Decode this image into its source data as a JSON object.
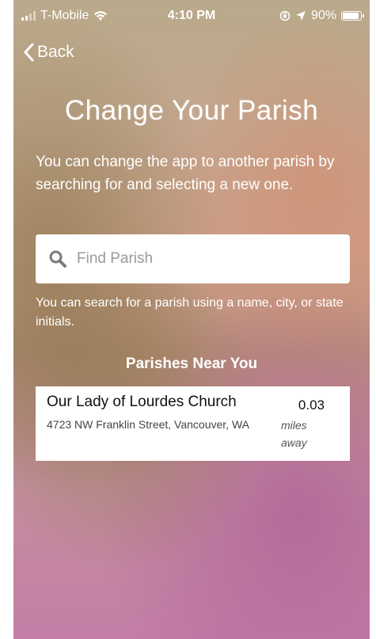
{
  "status_bar": {
    "carrier": "T-Mobile",
    "time": "4:10 PM",
    "battery": "90%",
    "battery_level": 0.9
  },
  "nav": {
    "back_label": "Back"
  },
  "page": {
    "title": "Change Your Parish",
    "intro": "You can change the app to another parish by searching for and selecting a new one.",
    "search_placeholder": "Find Parish",
    "hint": "You can search for a parish using a name, city, or state initials.",
    "section_heading": "Parishes Near You"
  },
  "parishes": [
    {
      "name": "Our Lady of Lourdes Church",
      "address": "4723 NW Franklin Street, Vancouver, WA",
      "distance": "0.03",
      "distance_unit": "miles away"
    }
  ],
  "icons": {
    "back": "chevron-left-icon",
    "search": "search-icon",
    "wifi": "wifi-icon",
    "location": "location-arrow-icon",
    "orientation_lock": "orientation-lock-icon"
  }
}
